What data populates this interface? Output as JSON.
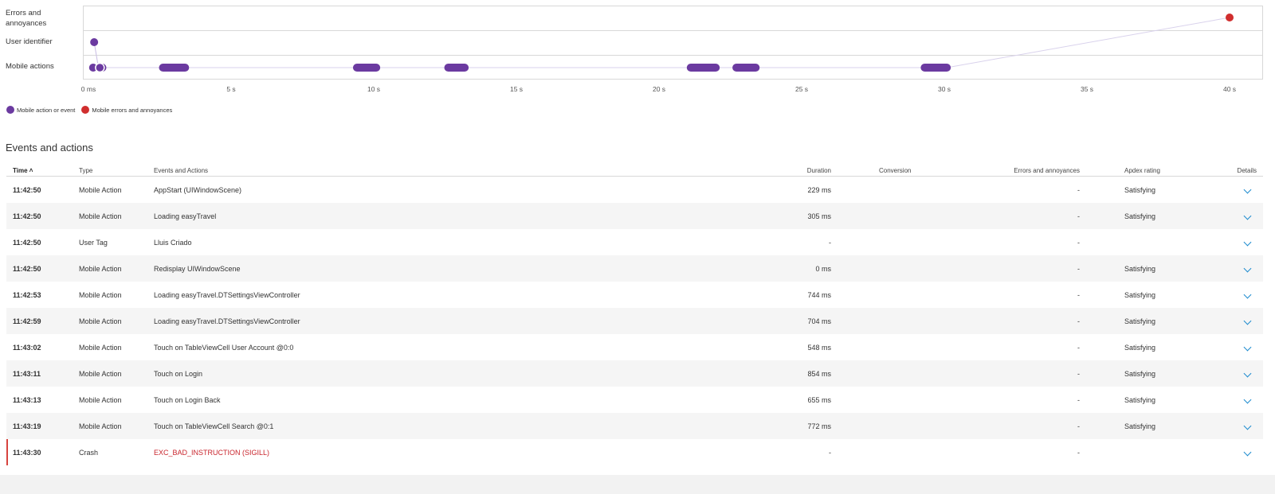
{
  "timeline": {
    "rows": [
      "Errors and annoyances",
      "User identifier",
      "Mobile actions"
    ],
    "ticks": [
      "0 ms",
      "5 s",
      "10 s",
      "15 s",
      "20 s",
      "25 s",
      "30 s",
      "35 s",
      "40 s"
    ],
    "legend": [
      {
        "label": "Mobile action or event",
        "color": "#6b3aa0"
      },
      {
        "label": "Mobile errors and annoyances",
        "color": "#d02e2e"
      }
    ],
    "action_bars_seconds": [
      [
        0.05,
        0.28
      ],
      [
        0.3,
        0.6
      ],
      [
        2.5,
        3.5
      ],
      [
        9.3,
        10.2
      ],
      [
        12.5,
        13.3
      ],
      [
        21.0,
        22.1
      ],
      [
        22.6,
        23.5
      ],
      [
        29.2,
        30.2
      ]
    ],
    "user_identifier_seconds": 0.2,
    "error_seconds": 40.0
  },
  "section_title": "Events and actions",
  "table": {
    "headers": {
      "time": "Time",
      "sort_indicator": "˄",
      "type": "Type",
      "events": "Events and Actions",
      "duration": "Duration",
      "conversion": "Conversion",
      "errors": "Errors and annoyances",
      "apdex": "Apdex rating",
      "details": "Details"
    },
    "rows": [
      {
        "time": "11:42:50",
        "type": "Mobile Action",
        "event": "AppStart (UIWindowScene)",
        "duration": "229 ms",
        "conversion": "",
        "errors": "-",
        "apdex": "Satisfying"
      },
      {
        "time": "11:42:50",
        "type": "Mobile Action",
        "event": "Loading easyTravel",
        "duration": "305 ms",
        "conversion": "",
        "errors": "-",
        "apdex": "Satisfying"
      },
      {
        "time": "11:42:50",
        "type": "User Tag",
        "event": "Lluis Criado",
        "duration": "-",
        "conversion": "",
        "errors": "-",
        "apdex": ""
      },
      {
        "time": "11:42:50",
        "type": "Mobile Action",
        "event": "Redisplay UIWindowScene",
        "duration": "0 ms",
        "conversion": "",
        "errors": "-",
        "apdex": "Satisfying"
      },
      {
        "time": "11:42:53",
        "type": "Mobile Action",
        "event": "Loading easyTravel.DTSettingsViewController",
        "duration": "744 ms",
        "conversion": "",
        "errors": "-",
        "apdex": "Satisfying"
      },
      {
        "time": "11:42:59",
        "type": "Mobile Action",
        "event": "Loading easyTravel.DTSettingsViewController",
        "duration": "704 ms",
        "conversion": "",
        "errors": "-",
        "apdex": "Satisfying"
      },
      {
        "time": "11:43:02",
        "type": "Mobile Action",
        "event": "Touch on TableViewCell User Account @0:0",
        "duration": "548 ms",
        "conversion": "",
        "errors": "-",
        "apdex": "Satisfying"
      },
      {
        "time": "11:43:11",
        "type": "Mobile Action",
        "event": "Touch on Login",
        "duration": "854 ms",
        "conversion": "",
        "errors": "-",
        "apdex": "Satisfying"
      },
      {
        "time": "11:43:13",
        "type": "Mobile Action",
        "event": "Touch on Login Back",
        "duration": "655 ms",
        "conversion": "",
        "errors": "-",
        "apdex": "Satisfying"
      },
      {
        "time": "11:43:19",
        "type": "Mobile Action",
        "event": "Touch on TableViewCell Search @0:1",
        "duration": "772 ms",
        "conversion": "",
        "errors": "-",
        "apdex": "Satisfying"
      },
      {
        "time": "11:43:30",
        "type": "Crash",
        "event": "EXC_BAD_INSTRUCTION (SIGILL)",
        "duration": "-",
        "conversion": "",
        "errors": "-",
        "apdex": "",
        "is_error": true
      }
    ]
  }
}
